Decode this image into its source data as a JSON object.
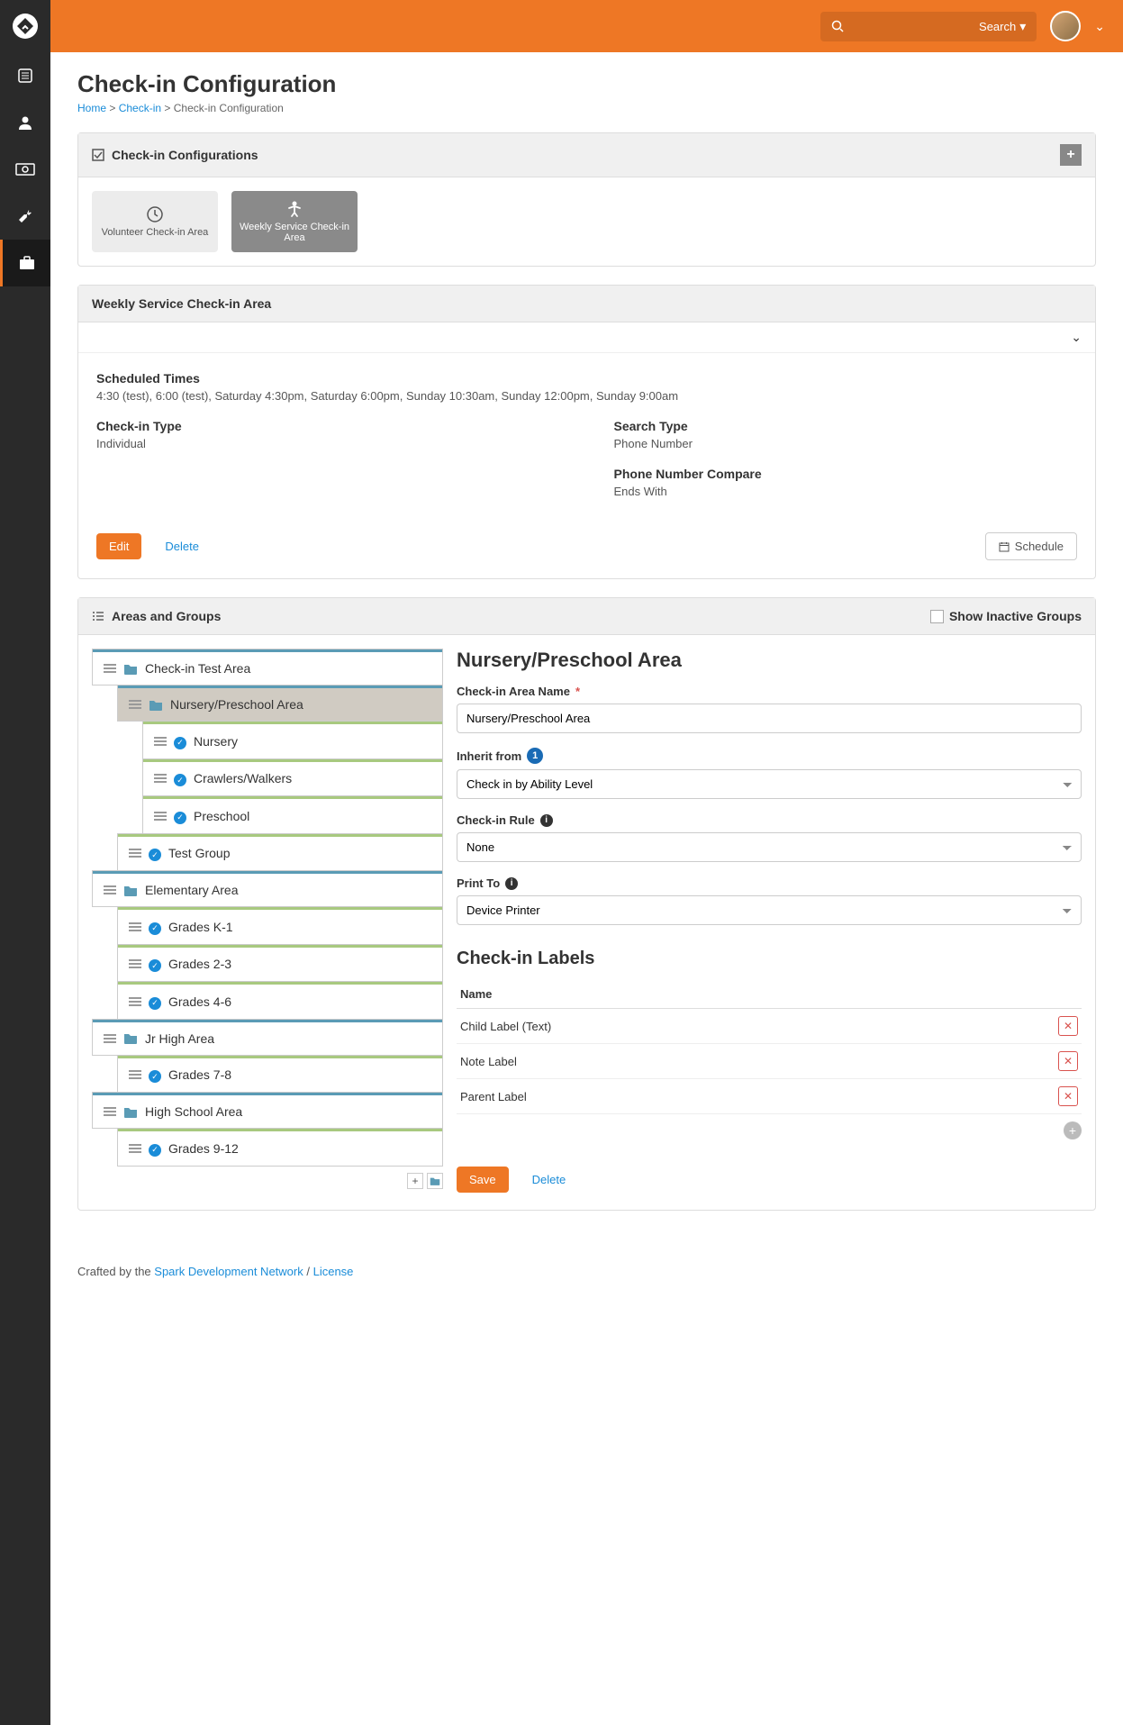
{
  "topbar": {
    "search_label": "Search"
  },
  "page": {
    "title": "Check-in Configuration"
  },
  "breadcrumb": {
    "home": "Home",
    "checkin": "Check-in",
    "current": "Check-in Configuration"
  },
  "configs": {
    "header": "Check-in Configurations",
    "tiles": [
      {
        "label": "Volunteer Check-in Area"
      },
      {
        "label": "Weekly Service Check-in Area"
      }
    ]
  },
  "area": {
    "title": "Weekly Service Check-in Area",
    "scheduled_label": "Scheduled Times",
    "scheduled_value": "4:30 (test), 6:00 (test), Saturday 4:30pm, Saturday 6:00pm, Sunday 10:30am, Sunday 12:00pm, Sunday 9:00am",
    "checkin_type_label": "Check-in Type",
    "checkin_type_value": "Individual",
    "search_type_label": "Search Type",
    "search_type_value": "Phone Number",
    "phone_compare_label": "Phone Number Compare",
    "phone_compare_value": "Ends With",
    "edit": "Edit",
    "delete": "Delete",
    "schedule": "Schedule"
  },
  "groups": {
    "header": "Areas and Groups",
    "show_inactive": "Show Inactive Groups"
  },
  "tree": [
    {
      "label": "Check-in Test Area",
      "type": "area",
      "indent": 0
    },
    {
      "label": "Nursery/Preschool Area",
      "type": "area",
      "indent": 1,
      "selected": true
    },
    {
      "label": "Nursery",
      "type": "group",
      "indent": 2
    },
    {
      "label": "Crawlers/Walkers",
      "type": "group",
      "indent": 2
    },
    {
      "label": "Preschool",
      "type": "group",
      "indent": 2
    },
    {
      "label": "Test Group",
      "type": "group",
      "indent": 1
    },
    {
      "label": "Elementary Area",
      "type": "area",
      "indent": 0
    },
    {
      "label": "Grades K-1",
      "type": "group",
      "indent": 1
    },
    {
      "label": "Grades 2-3",
      "type": "group",
      "indent": 1
    },
    {
      "label": "Grades 4-6",
      "type": "group",
      "indent": 1
    },
    {
      "label": "Jr High Area",
      "type": "area",
      "indent": 0
    },
    {
      "label": "Grades 7-8",
      "type": "group",
      "indent": 1
    },
    {
      "label": "High School Area",
      "type": "area",
      "indent": 0
    },
    {
      "label": "Grades 9-12",
      "type": "group",
      "indent": 1
    }
  ],
  "form": {
    "title": "Nursery/Preschool Area",
    "name_label": "Check-in Area Name",
    "name_value": "Nursery/Preschool Area",
    "inherit_label": "Inherit from",
    "inherit_value": "Check in by Ability Level",
    "rule_label": "Check-in Rule",
    "rule_value": "None",
    "print_label": "Print To",
    "print_value": "Device Printer",
    "labels_title": "Check-in Labels",
    "name_col": "Name",
    "labels": [
      {
        "name": "Child Label (Text)"
      },
      {
        "name": "Note Label"
      },
      {
        "name": "Parent Label"
      }
    ],
    "save": "Save",
    "delete": "Delete"
  },
  "footer": {
    "crafted": "Crafted by the ",
    "network": "Spark Development Network",
    "sep": " / ",
    "license": "License"
  }
}
